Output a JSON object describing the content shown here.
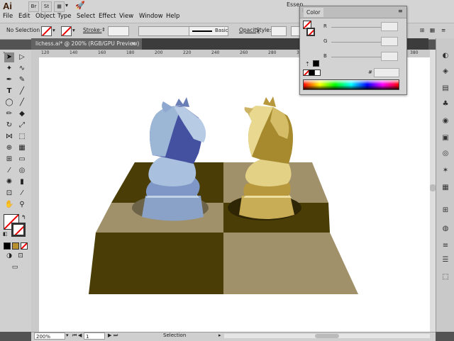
{
  "app": {
    "logo": "Ai",
    "workspace": "Essen",
    "top_icons": [
      "Br",
      "St"
    ]
  },
  "menu": [
    "File",
    "Edit",
    "Object",
    "Type",
    "Select",
    "Effect",
    "View",
    "Window",
    "Help"
  ],
  "control_bar": {
    "selection_label": "No Selection",
    "stroke_label": "Stroke:",
    "brush_label": "Basic",
    "opacity_label": "Opacity",
    "style_label": "Style:"
  },
  "document_tab": {
    "title": "lichess.ai* @ 200% (RGB/GPU Preview)",
    "close": "×"
  },
  "ruler": {
    "ticks": [
      "120",
      "140",
      "160",
      "180",
      "200",
      "220",
      "240",
      "260",
      "280",
      "300",
      "320",
      "340",
      "360",
      "380"
    ]
  },
  "color_panel": {
    "title": "Color",
    "channels": [
      {
        "label": "R"
      },
      {
        "label": "G"
      },
      {
        "label": "B"
      }
    ],
    "hex_prefix": "#"
  },
  "status_bar": {
    "zoom": "200%",
    "artboard": "1",
    "mode": "Selection"
  },
  "colors": {
    "board_dark": "#4a3e06",
    "board_light": "#a1916a",
    "knight_blue_light": "#9cb6d6",
    "knight_blue_dark": "#4451a0",
    "knight_gold_light": "#e8d890",
    "knight_gold_dark": "#a88a2e"
  }
}
